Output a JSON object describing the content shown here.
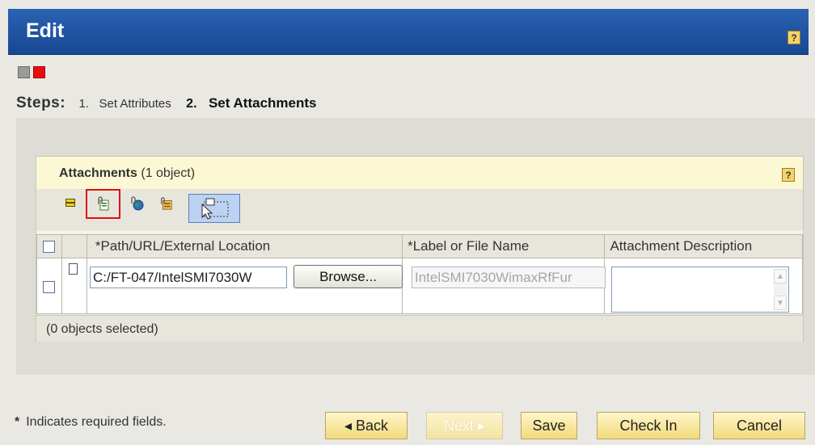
{
  "window": {
    "title": "Edit",
    "help_label": "?"
  },
  "steps": {
    "label": "Steps:",
    "items": [
      {
        "num": "1.",
        "label": "Set Attributes",
        "active": false
      },
      {
        "num": "2.",
        "label": "Set Attachments",
        "active": true
      }
    ]
  },
  "attachments": {
    "title_bold": "Attachments",
    "title_count": "(1 object)",
    "help_label": "?",
    "toolbar_icons": [
      "insert-row-icon",
      "attach-file-icon",
      "attach-url-icon",
      "attach-external-icon",
      "select-mode-icon"
    ],
    "columns": [
      "*Path/URL/External Location",
      "*Label or File Name",
      "Attachment Description"
    ],
    "rows": [
      {
        "path": "C:/FT-047/IntelSMI7030W",
        "browse_label": "Browse...",
        "label": "IntelSMI7030WimaxRfFur",
        "description": ""
      }
    ],
    "status": "(0 objects selected)"
  },
  "footer": {
    "required_star": "*",
    "required_note": "Indicates required fields.",
    "buttons": {
      "back": "Back",
      "next": "Next",
      "save": "Save",
      "check_in": "Check In",
      "cancel": "Cancel"
    }
  },
  "colors": {
    "titlebar": "#2056a8",
    "accent_red": "#e60d0d",
    "button_yellow": "#f2da7c"
  }
}
